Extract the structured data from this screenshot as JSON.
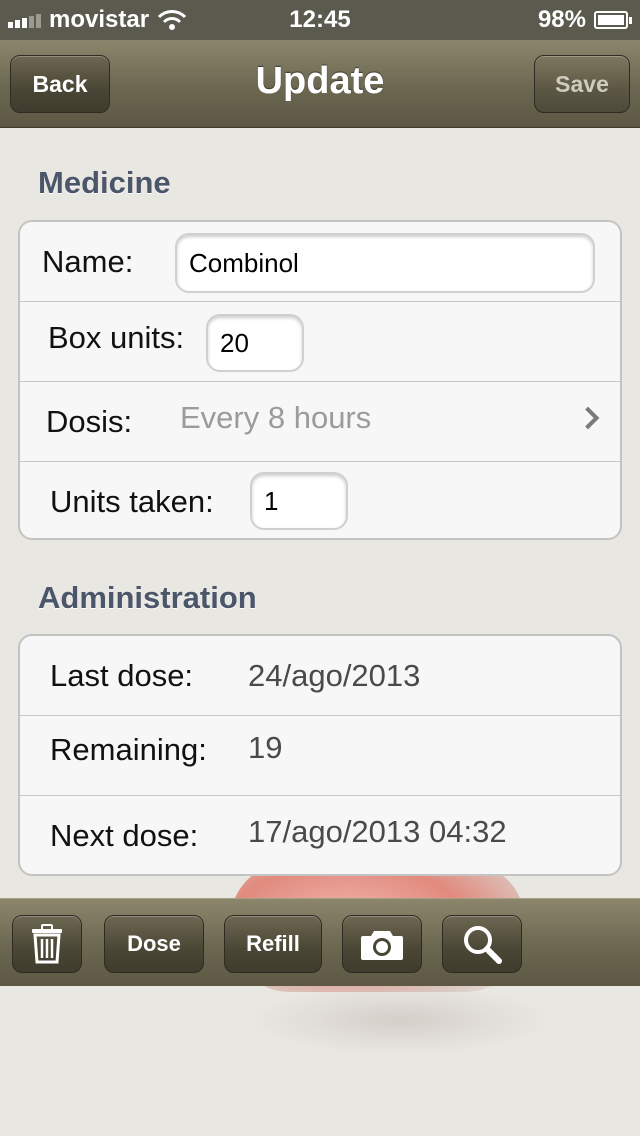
{
  "status_bar": {
    "carrier": "movistar",
    "time": "12:45",
    "battery": "98%",
    "battery_level": 0.98
  },
  "nav": {
    "title": "Update",
    "back_label": "Back",
    "save_label": "Save"
  },
  "medicine": {
    "header": "Medicine",
    "name_label": "Name:",
    "name_value": "Combinol",
    "box_units_label": "Box units:",
    "box_units_value": "20",
    "dosis_label": "Dosis:",
    "dosis_value": "Every 8 hours",
    "units_taken_label": "Units taken:",
    "units_taken_value": "1"
  },
  "administration": {
    "header": "Administration",
    "last_dose_label": "Last dose:",
    "last_dose_value": "24/ago/2013",
    "remaining_label": "Remaining:",
    "remaining_value": "19",
    "next_dose_label": "Next dose:",
    "next_dose_value": "17/ago/2013 04:32"
  },
  "toolbar": {
    "dose_label": "Dose",
    "refill_label": "Refill",
    "icons": [
      "trash-icon",
      "camera-icon",
      "search-icon"
    ]
  }
}
